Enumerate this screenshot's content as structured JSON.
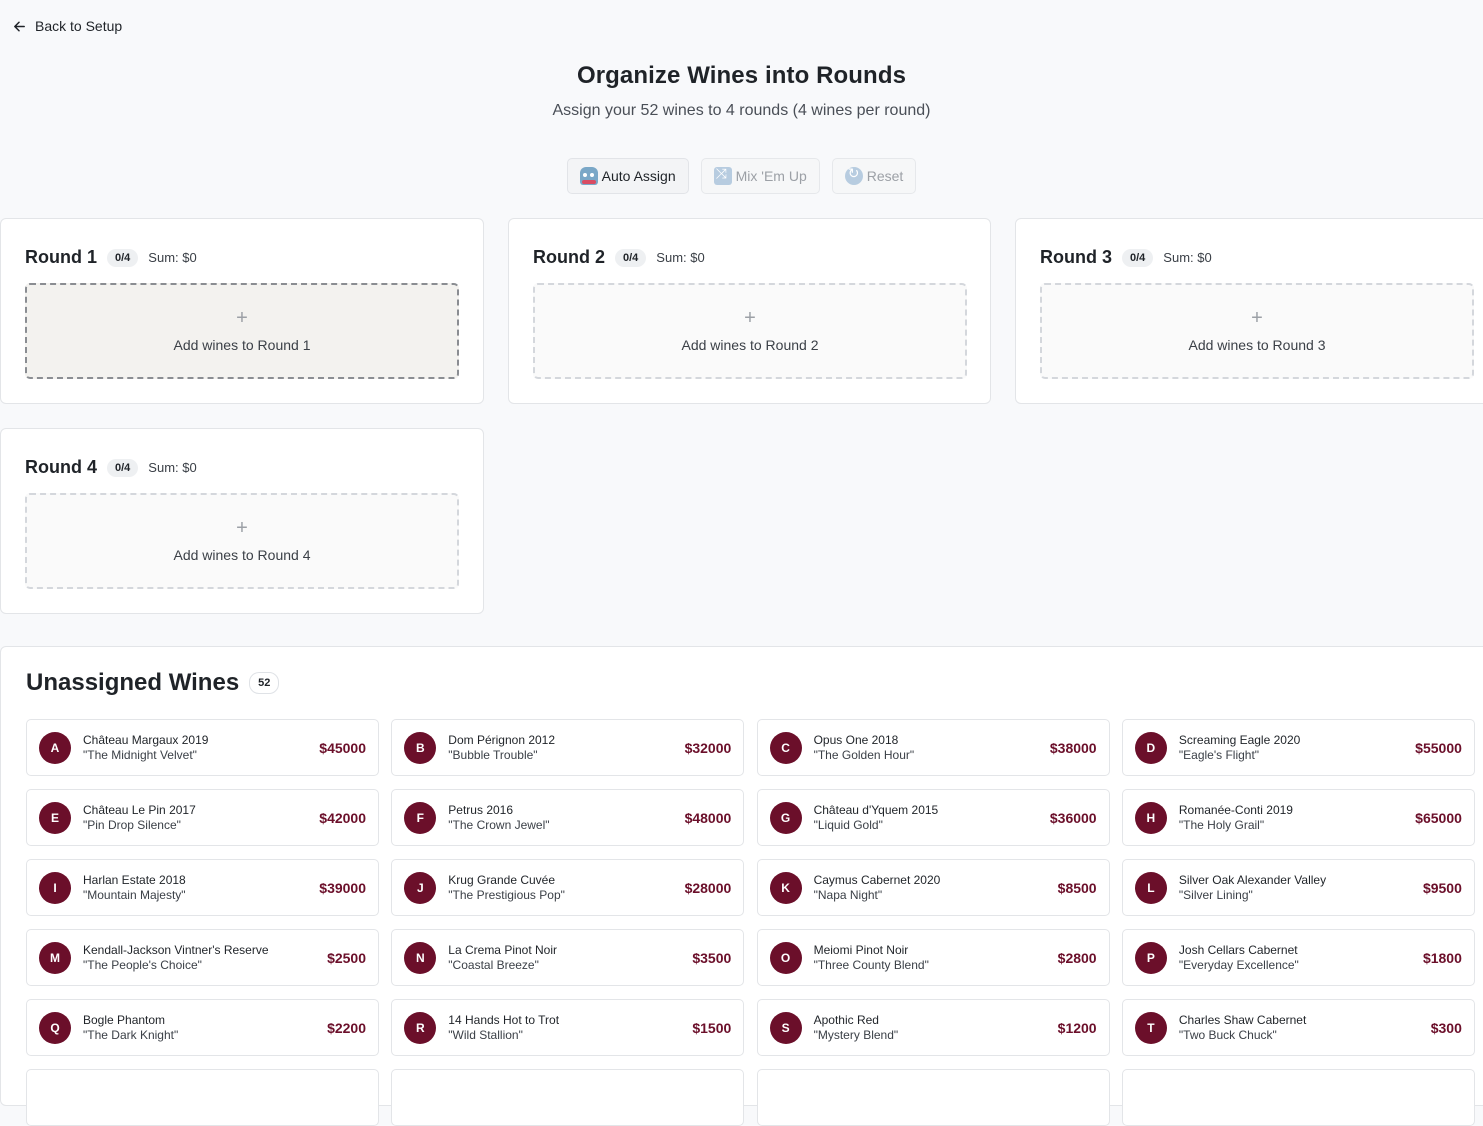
{
  "nav": {
    "back_label": "Back to Setup"
  },
  "header": {
    "title": "Organize Wines into Rounds",
    "subtitle": "Assign your 52 wines to 4 rounds (4 wines per round)"
  },
  "actions": {
    "auto_assign": "Auto Assign",
    "mix_em_up": "Mix 'Em Up",
    "reset": "Reset"
  },
  "rounds": [
    {
      "title": "Round 1",
      "count": "0/4",
      "sum": "Sum: $0",
      "placeholder_plus": "+",
      "placeholder": "Add wines to Round 1"
    },
    {
      "title": "Round 2",
      "count": "0/4",
      "sum": "Sum: $0",
      "placeholder_plus": "+",
      "placeholder": "Add wines to Round 2"
    },
    {
      "title": "Round 3",
      "count": "0/4",
      "sum": "Sum: $0",
      "placeholder_plus": "+",
      "placeholder": "Add wines to Round 3"
    },
    {
      "title": "Round 4",
      "count": "0/4",
      "sum": "Sum: $0",
      "placeholder_plus": "+",
      "placeholder": "Add wines to Round 4"
    }
  ],
  "unassigned": {
    "title": "Unassigned Wines",
    "count": "52",
    "wines": [
      {
        "letter": "A",
        "name": "Château Margaux 2019",
        "nickname": "\"The Midnight Velvet\"",
        "price": "$45000"
      },
      {
        "letter": "B",
        "name": "Dom Pérignon 2012",
        "nickname": "\"Bubble Trouble\"",
        "price": "$32000"
      },
      {
        "letter": "C",
        "name": "Opus One 2018",
        "nickname": "\"The Golden Hour\"",
        "price": "$38000"
      },
      {
        "letter": "D",
        "name": "Screaming Eagle 2020",
        "nickname": "\"Eagle's Flight\"",
        "price": "$55000"
      },
      {
        "letter": "E",
        "name": "Château Le Pin 2017",
        "nickname": "\"Pin Drop Silence\"",
        "price": "$42000"
      },
      {
        "letter": "F",
        "name": "Petrus 2016",
        "nickname": "\"The Crown Jewel\"",
        "price": "$48000"
      },
      {
        "letter": "G",
        "name": "Château d'Yquem 2015",
        "nickname": "\"Liquid Gold\"",
        "price": "$36000"
      },
      {
        "letter": "H",
        "name": "Romanée-Conti 2019",
        "nickname": "\"The Holy Grail\"",
        "price": "$65000"
      },
      {
        "letter": "I",
        "name": "Harlan Estate 2018",
        "nickname": "\"Mountain Majesty\"",
        "price": "$39000"
      },
      {
        "letter": "J",
        "name": "Krug Grande Cuvée",
        "nickname": "\"The Prestigious Pop\"",
        "price": "$28000"
      },
      {
        "letter": "K",
        "name": "Caymus Cabernet 2020",
        "nickname": "\"Napa Night\"",
        "price": "$8500"
      },
      {
        "letter": "L",
        "name": "Silver Oak Alexander Valley",
        "nickname": "\"Silver Lining\"",
        "price": "$9500"
      },
      {
        "letter": "M",
        "name": "Kendall-Jackson Vintner's Reserve",
        "nickname": "\"The People's Choice\"",
        "price": "$2500"
      },
      {
        "letter": "N",
        "name": "La Crema Pinot Noir",
        "nickname": "\"Coastal Breeze\"",
        "price": "$3500"
      },
      {
        "letter": "O",
        "name": "Meiomi Pinot Noir",
        "nickname": "\"Three County Blend\"",
        "price": "$2800"
      },
      {
        "letter": "P",
        "name": "Josh Cellars Cabernet",
        "nickname": "\"Everyday Excellence\"",
        "price": "$1800"
      },
      {
        "letter": "Q",
        "name": "Bogle Phantom",
        "nickname": "\"The Dark Knight\"",
        "price": "$2200"
      },
      {
        "letter": "R",
        "name": "14 Hands Hot to Trot",
        "nickname": "\"Wild Stallion\"",
        "price": "$1500"
      },
      {
        "letter": "S",
        "name": "Apothic Red",
        "nickname": "\"Mystery Blend\"",
        "price": "$1200"
      },
      {
        "letter": "T",
        "name": "Charles Shaw Cabernet",
        "nickname": "\"Two Buck Chuck\"",
        "price": "$300"
      }
    ]
  }
}
